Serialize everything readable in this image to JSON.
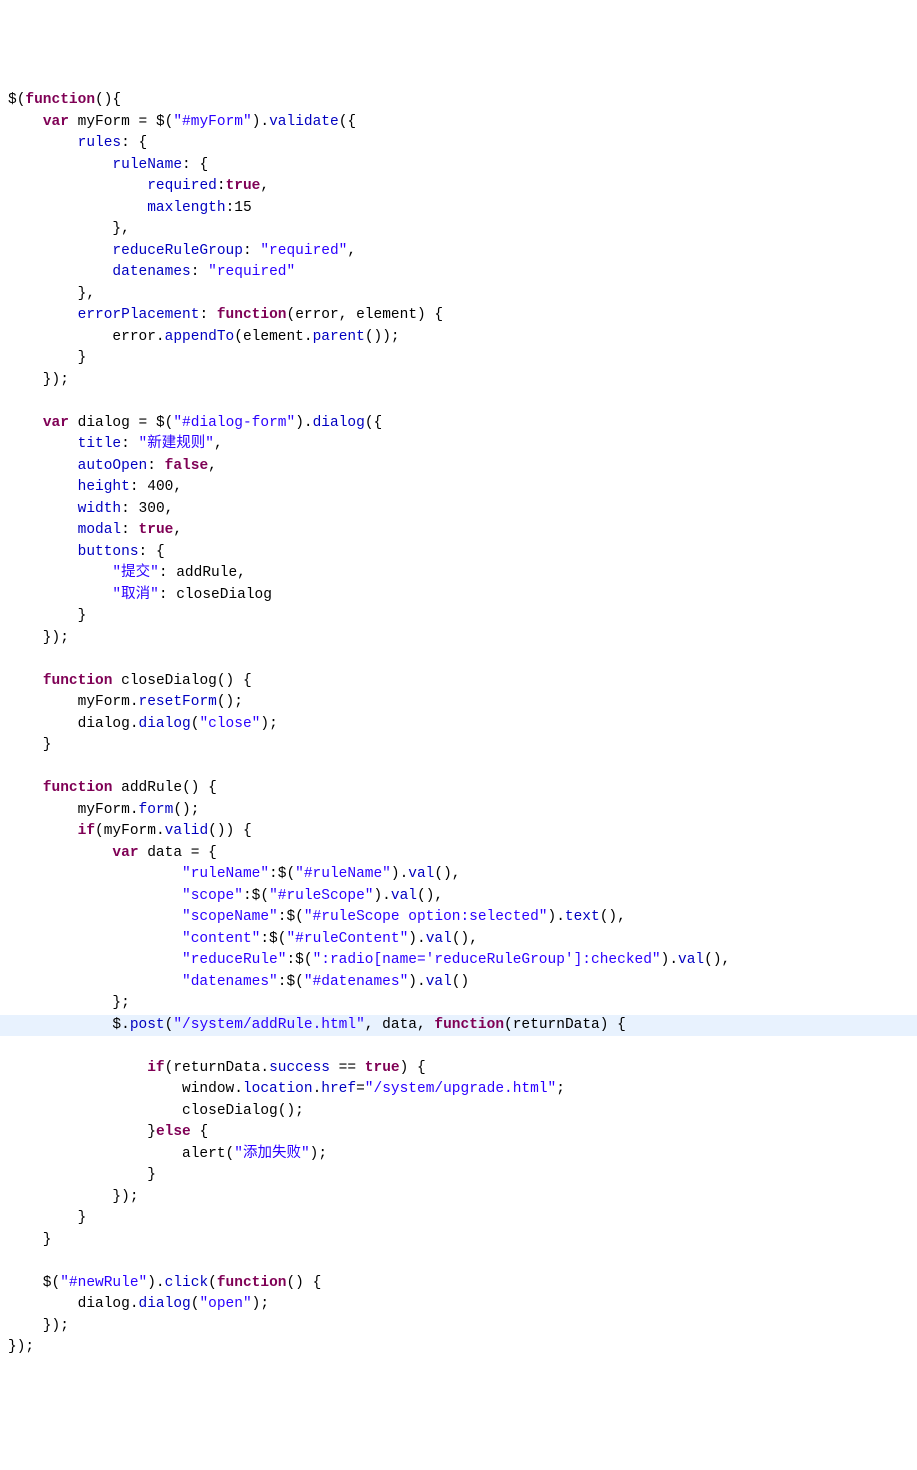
{
  "lang": "javascript",
  "highlighted_line_index": 42,
  "tokens": {
    "kw": {
      "function": "function",
      "var": "var",
      "true": "true",
      "false": "false",
      "if": "if",
      "else": "else"
    },
    "strings": {
      "myForm": "\"#myForm\"",
      "required": "\"required\"",
      "dialogForm": "\"#dialog-form\"",
      "title": "\"新建规则\"",
      "submit": "\"提交\"",
      "cancel": "\"取消\"",
      "close": "\"close\"",
      "ruleNameKey": "\"ruleName\"",
      "ruleNameSel": "\"#ruleName\"",
      "scopeKey": "\"scope\"",
      "ruleScopeSel": "\"#ruleScope\"",
      "scopeNameKey": "\"scopeName\"",
      "ruleScopeOpt": "\"#ruleScope option:selected\"",
      "contentKey": "\"content\"",
      "ruleContentSel": "\"#ruleContent\"",
      "reduceRuleKey": "\"reduceRule\"",
      "radioSel": "\":radio[name='reduceRuleGroup']:checked\"",
      "datenamesKey": "\"datenames\"",
      "datenamesSel": "\"#datenames\"",
      "addRuleUrl": "\"/system/addRule.html\"",
      "upgradeUrl": "\"/system/upgrade.html\"",
      "addFail": "\"添加失败\"",
      "newRuleSel": "\"#newRule\"",
      "open": "\"open\""
    },
    "numbers": {
      "fifteen": "15",
      "fourHundred": "400",
      "threeHundred": "300"
    },
    "members": {
      "validate": "validate",
      "rules": "rules",
      "ruleName": "ruleName",
      "required": "required",
      "maxlength": "maxlength",
      "reduceRuleGroup": "reduceRuleGroup",
      "datenames": "datenames",
      "errorPlacement": "errorPlacement",
      "appendTo": "appendTo",
      "parent": "parent",
      "dialog": "dialog",
      "title": "title",
      "autoOpen": "autoOpen",
      "height": "height",
      "width": "width",
      "modal": "modal",
      "buttons": "buttons",
      "resetForm": "resetForm",
      "form": "form",
      "valid": "valid",
      "val": "val",
      "text": "text",
      "post": "post",
      "success": "success",
      "location": "location",
      "href": "href",
      "click": "click"
    },
    "plain": {
      "jq": "$",
      "lp": "(",
      "rp": ")",
      "lb": "{",
      "rb": "}",
      "sc": ";",
      "cm": ",",
      "dot": ".",
      "colon": ": ",
      "myFormVar": "myForm",
      "dialogVar": "dialog",
      "errorVar": "error",
      "elementVar": "element",
      "dataVar": "data",
      "returnDataVar": "returnData",
      "window": "window",
      "alert": "alert",
      "closeDialogFn": "closeDialog",
      "addRuleFn": "addRule",
      "eqeq": " == ",
      "assign": " = "
    }
  }
}
